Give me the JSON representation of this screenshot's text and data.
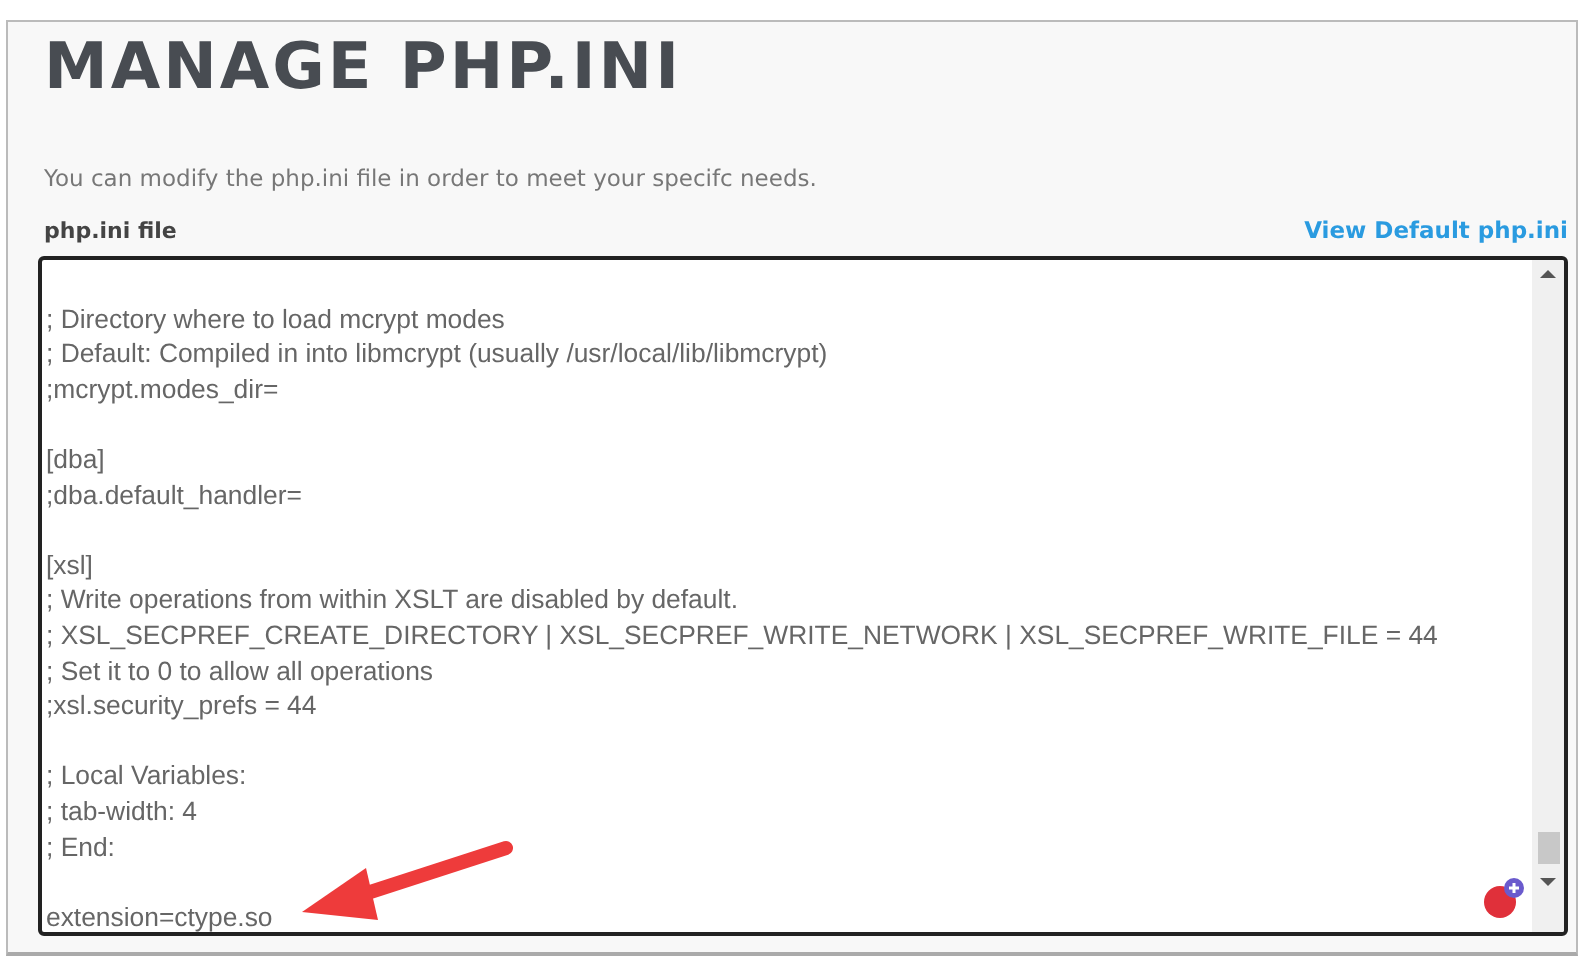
{
  "title": "MANAGE PHP.INI",
  "description": "You can modify the php.ini file in order to meet your specifc needs.",
  "editor": {
    "label": "php.ini file",
    "link": "View Default php.ini",
    "blocks": [
      [
        "; Directory where to load mcrypt modes",
        "; Default: Compiled in into libmcrypt (usually /usr/local/lib/libmcrypt)",
        ";mcrypt.modes_dir="
      ],
      [
        "[dba]",
        ";dba.default_handler="
      ],
      [
        "[xsl]",
        "; Write operations from within XSLT are disabled by default.",
        "; XSL_SECPREF_CREATE_DIRECTORY | XSL_SECPREF_WRITE_NETWORK | XSL_SECPREF_WRITE_FILE = 44",
        "; Set it to 0 to allow all operations",
        ";xsl.security_prefs = 44"
      ],
      [
        "; Local Variables:",
        "; tab-width: 4",
        "; End:"
      ],
      [
        "extension=ctype.so"
      ]
    ]
  }
}
